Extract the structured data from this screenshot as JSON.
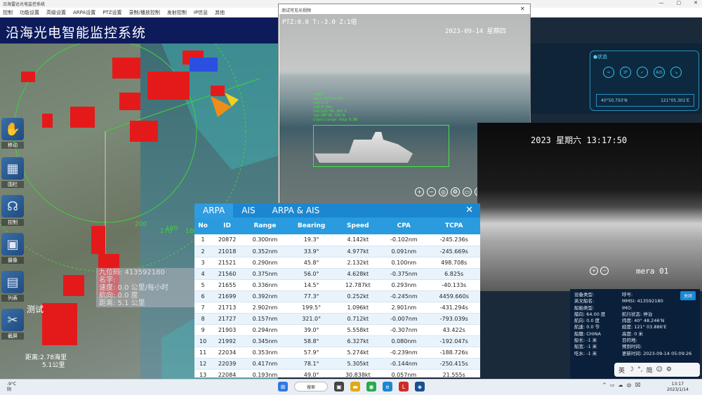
{
  "window": {
    "title": "沿海雷达光电监控系统",
    "controls": [
      "—",
      "▢",
      "✕"
    ]
  },
  "menu": [
    "控制",
    "功能设置",
    "高级设置",
    "ARPA设置",
    "PTZ设置",
    "录制/播放控制",
    "发射控制",
    "IP信息",
    "其他"
  ],
  "app_title": "沿海光电智能监控系统",
  "tools": [
    {
      "label": "移动",
      "icon": "hand-icon"
    },
    {
      "label": "围栏",
      "icon": "fence-icon"
    },
    {
      "label": "控制",
      "icon": "control-icon"
    },
    {
      "label": "摄像",
      "icon": "camera-icon"
    },
    {
      "label": "列表",
      "icon": "list-icon"
    },
    {
      "label": "截屏",
      "icon": "scissors-icon"
    }
  ],
  "map": {
    "range_labels": [
      "190",
      "200",
      "170",
      "180"
    ],
    "target_box_lines": [
      "九位码:  413592180",
      "名字:",
      "速度: 0.0 公里/每小时",
      "航向: 0.0 度",
      "距离: 5.1 公里"
    ],
    "map_label_1": "测试",
    "map_label_2": "距离:2.78海里",
    "map_label_3": "5.1公里"
  },
  "video1": {
    "title": "测试可见光视频",
    "osd_left": "PTZ:0.0 T:-3.0 Z:1倍",
    "osd_right": "2023-09-14 星期四",
    "detection": [
      "name:",
      "mmsi:413592180",
      "cog:0.0°",
      "sog:0.0kn",
      "lon:121°05.301'E",
      "lat:40°50.793'N",
      "class:cargo ship 0.86"
    ]
  },
  "status_panel": {
    "header": "●状态",
    "icons": [
      "wifi-icon",
      "ip-icon",
      "check-icon",
      "ais-icon",
      "radar-icon"
    ],
    "icon_labels": [
      "≈",
      "IP",
      "✓",
      "AIS",
      "↘"
    ],
    "lat": "40°50.793'N",
    "lon": "121°05.301'E"
  },
  "thermal": {
    "clock": "2023 星期六 13:17:50",
    "cam_label": "mera 01"
  },
  "arpa": {
    "tabs": [
      "ARPA",
      "AIS",
      "ARPA & AIS"
    ],
    "active_tab": 0,
    "close": "✕",
    "columns": [
      "No",
      "ID",
      "Range",
      "Bearing",
      "Speed",
      "CPA",
      "TCPA"
    ],
    "rows": [
      [
        "1",
        "20872",
        "0.300nm",
        "19.3°",
        "4.142kt",
        "-0.102nm",
        "-245.236s"
      ],
      [
        "2",
        "21018",
        "0.352nm",
        "33.9°",
        "4.977kt",
        "0.091nm",
        "-245.669s"
      ],
      [
        "3",
        "21521",
        "0.290nm",
        "45.8°",
        "2.132kt",
        "0.100nm",
        "498.708s"
      ],
      [
        "4",
        "21560",
        "0.375nm",
        "56.0°",
        "4.628kt",
        "-0.375nm",
        "6.825s"
      ],
      [
        "5",
        "21655",
        "0.336nm",
        "14.5°",
        "12.787kt",
        "0.293nm",
        "-40.133s"
      ],
      [
        "6",
        "21699",
        "0.392nm",
        "77.3°",
        "0.252kt",
        "-0.245nm",
        "4459.660s"
      ],
      [
        "7",
        "21713",
        "2.902nm",
        "199.5°",
        "1.096kt",
        "2.901nm",
        "-431.294s"
      ],
      [
        "8",
        "21727",
        "0.157nm",
        "321.0°",
        "0.712kt",
        "-0.007nm",
        "-793.039s"
      ],
      [
        "9",
        "21903",
        "0.294nm",
        "39.0°",
        "5.558kt",
        "-0.307nm",
        "43.422s"
      ],
      [
        "10",
        "21992",
        "0.345nm",
        "58.8°",
        "6.327kt",
        "0.080nm",
        "-192.047s"
      ],
      [
        "11",
        "22034",
        "0.353nm",
        "57.9°",
        "5.274kt",
        "-0.239nm",
        "-188.726s"
      ],
      [
        "12",
        "22039",
        "0.417nm",
        "78.1°",
        "5.305kt",
        "-0.144nm",
        "-250.415s"
      ],
      [
        "13",
        "22084",
        "0.193nm",
        "49.0°",
        "30.838kt",
        "0.057nm",
        "21.555s"
      ]
    ]
  },
  "info_panel": {
    "close_label": "关闭",
    "rows": [
      [
        "设备类型:",
        "呼号:"
      ],
      [
        "英文船名:",
        "MMSI: 413592180"
      ],
      [
        "船舶类型:",
        "IMO:"
      ],
      [
        "艏向: 64.00 度",
        "航行状态: 停泊"
      ],
      [
        "航向: 0.0 度",
        "纬度: 40° 48.246'N"
      ],
      [
        "航速: 0.0 节",
        "经度: 121° 03.886'E"
      ],
      [
        "船籍: CHINA",
        "高度: 0 米"
      ],
      [
        "船长: -1 米",
        "目的地:"
      ],
      [
        "船宽: -1 米",
        "预到时间:"
      ],
      [
        "吃水: -1 米",
        "更新时间: 2023-09-14 05:09:26"
      ]
    ]
  },
  "ime": [
    "英",
    "☽",
    "°,",
    "简",
    "☺",
    "⚙"
  ],
  "taskbar": {
    "weather_temp": "-9°C",
    "weather_desc": "阴",
    "search": "搜索",
    "time": "13:17",
    "date": "2023/1/14",
    "tray": [
      "^",
      "▭",
      "☁",
      "中",
      "⌧"
    ]
  }
}
